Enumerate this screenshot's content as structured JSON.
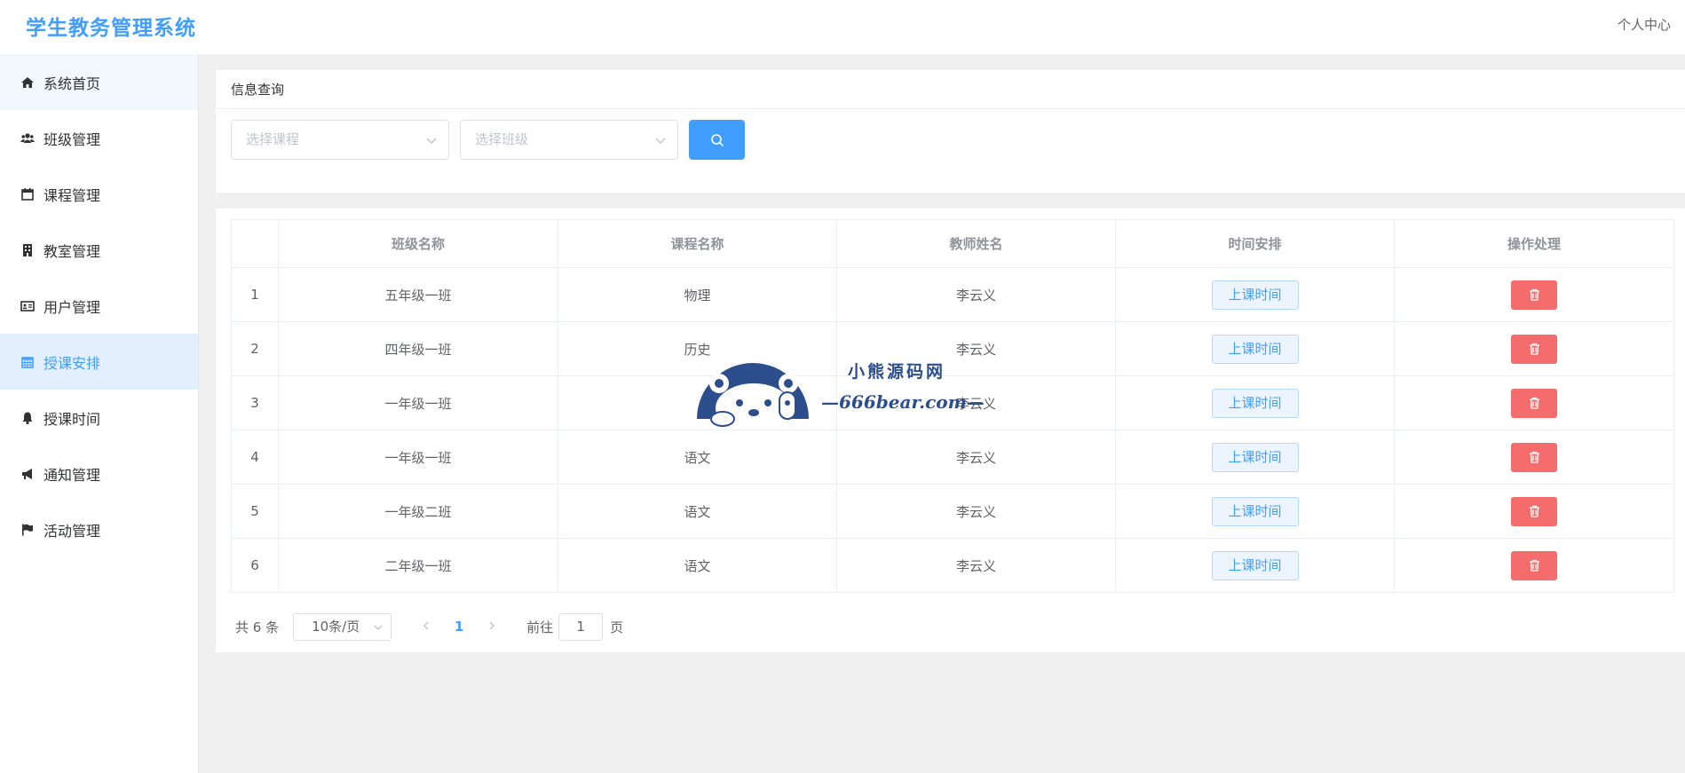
{
  "header": {
    "title": "学生教务管理系统",
    "user_center": "个人中心"
  },
  "sidebar": {
    "items": [
      {
        "label": "系统首页",
        "icon": "home-icon"
      },
      {
        "label": "班级管理",
        "icon": "users-icon"
      },
      {
        "label": "课程管理",
        "icon": "calendar-blank-icon"
      },
      {
        "label": "教室管理",
        "icon": "building-icon"
      },
      {
        "label": "用户管理",
        "icon": "id-card-icon"
      },
      {
        "label": "授课安排",
        "icon": "calendar-icon"
      },
      {
        "label": "授课时间",
        "icon": "bell-icon"
      },
      {
        "label": "通知管理",
        "icon": "bullhorn-icon"
      },
      {
        "label": "活动管理",
        "icon": "flag-icon"
      }
    ],
    "active": "授课安排"
  },
  "query": {
    "title": "信息查询",
    "course_placeholder": "选择课程",
    "class_placeholder": "选择班级"
  },
  "table": {
    "columns": [
      "",
      "班级名称",
      "课程名称",
      "教师姓名",
      "时间安排",
      "操作处理"
    ],
    "time_button_label": "上课时间",
    "rows": [
      {
        "index": "1",
        "class": "五年级一班",
        "course": "物理",
        "teacher": "李云义"
      },
      {
        "index": "2",
        "class": "四年级一班",
        "course": "历史",
        "teacher": "李云义"
      },
      {
        "index": "3",
        "class": "一年级一班",
        "course": "",
        "teacher": "李云义"
      },
      {
        "index": "4",
        "class": "一年级一班",
        "course": "语文",
        "teacher": "李云义"
      },
      {
        "index": "5",
        "class": "一年级二班",
        "course": "语文",
        "teacher": "李云义"
      },
      {
        "index": "6",
        "class": "二年级一班",
        "course": "语文",
        "teacher": "李云义"
      }
    ]
  },
  "pagination": {
    "total": "共 6 条",
    "page_size": "10条/页",
    "current_page": "1",
    "goto_label": "前往",
    "goto_value": "1",
    "page_suffix": "页"
  },
  "watermark": {
    "name": "小熊源码网",
    "url": "—666bear.com—"
  },
  "colors": {
    "primary": "#409eff",
    "danger": "#f56c6c",
    "watermark": "#2d4e8c"
  }
}
